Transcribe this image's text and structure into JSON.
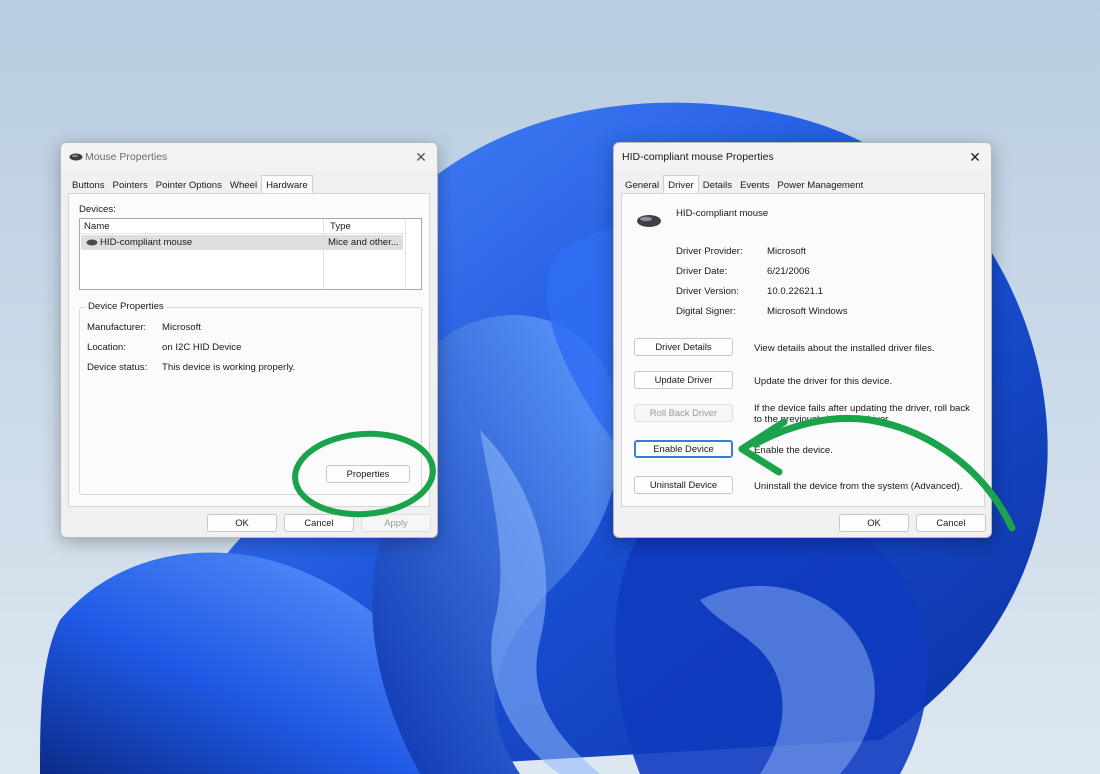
{
  "colors": {
    "annotation_green": "#1aa34a",
    "wallpaper_blue": "#1b53d9"
  },
  "mouse_dialog": {
    "title": "Mouse Properties",
    "close_icon": "close-icon",
    "tabs": [
      "Buttons",
      "Pointers",
      "Pointer Options",
      "Wheel",
      "Hardware"
    ],
    "active_tab": "Hardware",
    "devices_label": "Devices:",
    "columns": [
      "Name",
      "Type"
    ],
    "device_row": {
      "name": "HID-compliant mouse",
      "type": "Mice and other..."
    },
    "group_title": "Device Properties",
    "properties": [
      {
        "label": "Manufacturer:",
        "value": "Microsoft"
      },
      {
        "label": "Location:",
        "value": "on I2C HID Device"
      },
      {
        "label": "Device status:",
        "value": "This device is working properly."
      }
    ],
    "properties_button": "Properties",
    "ok": "OK",
    "cancel": "Cancel",
    "apply": "Apply"
  },
  "hid_dialog": {
    "title": "HID-compliant mouse Properties",
    "tabs": [
      "General",
      "Driver",
      "Details",
      "Events",
      "Power Management"
    ],
    "active_tab": "Driver",
    "device_name": "HID-compliant mouse",
    "info": [
      {
        "label": "Driver Provider:",
        "value": "Microsoft"
      },
      {
        "label": "Driver Date:",
        "value": "6/21/2006"
      },
      {
        "label": "Driver Version:",
        "value": "10.0.22621.1"
      },
      {
        "label": "Digital Signer:",
        "value": "Microsoft Windows"
      }
    ],
    "actions": [
      {
        "button": "Driver Details",
        "description": "View details about the installed driver files.",
        "state": "normal"
      },
      {
        "button": "Update Driver",
        "description": "Update the driver for this device.",
        "state": "normal"
      },
      {
        "button": "Roll Back Driver",
        "description": "If the device fails after updating the driver, roll back to the previously installed driver.",
        "description_line1": "If the device fails after updating the driver, roll back",
        "description_line2": "to the previously installed driver.",
        "state": "disabled"
      },
      {
        "button": "Enable Device",
        "description": "Enable the device.",
        "state": "focused"
      },
      {
        "button": "Uninstall Device",
        "description": "Uninstall the device from the system (Advanced).",
        "state": "normal"
      }
    ],
    "ok": "OK",
    "cancel": "Cancel"
  }
}
